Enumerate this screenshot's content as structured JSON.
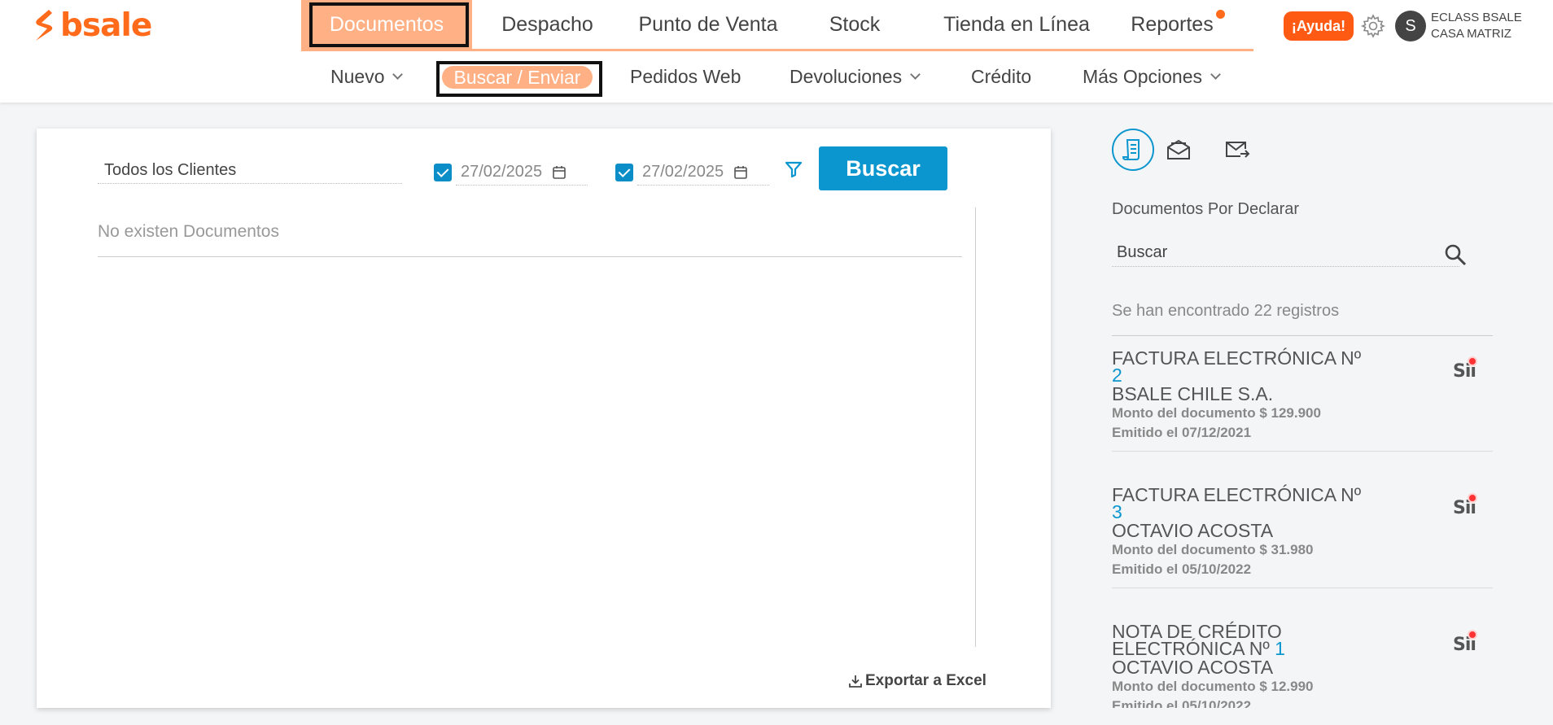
{
  "brand": {
    "logo_text": "bsale",
    "color": "#ff6b1a"
  },
  "main_nav": {
    "items": [
      "Documentos",
      "Despacho",
      "Punto de Venta",
      "Stock",
      "Tienda en Línea",
      "Reportes"
    ],
    "active": "Documentos"
  },
  "header": {
    "help_label": "¡Ayuda!",
    "avatar_initial": "S",
    "company_line1": "ECLASS BSALE",
    "company_line2": "CASA MATRIZ"
  },
  "sub_nav": {
    "items": [
      "Nuevo",
      "Buscar / Enviar",
      "Pedidos Web",
      "Devoluciones",
      "Crédito",
      "Más Opciones"
    ],
    "active": "Buscar / Enviar"
  },
  "search_form": {
    "client_placeholder": "Todos los Clientes",
    "date_from": "27/02/2025",
    "date_to": "27/02/2025",
    "search_label": "Buscar"
  },
  "results": {
    "empty_message": "No existen Documentos"
  },
  "export_label": "Exportar a Excel",
  "side_panel": {
    "title": "Documentos Por Declarar",
    "search_placeholder": "Buscar",
    "found_text": "Se han encontrado 22 registros",
    "documents": [
      {
        "title": "FACTURA ELECTRÓNICA Nº",
        "number": "2",
        "client": "BSALE CHILE S.A.",
        "amount": "Monto del documento $ 129.900",
        "issued": "Emitido el 07/12/2021"
      },
      {
        "title": "FACTURA ELECTRÓNICA Nº",
        "number": "3",
        "client": "OCTAVIO ACOSTA",
        "amount": "Monto del documento $ 31.980",
        "issued": "Emitido el 05/10/2022"
      },
      {
        "title": "NOTA DE CRÉDITO ELECTRÓNICA Nº",
        "number": "1",
        "client": "OCTAVIO ACOSTA",
        "amount": "Monto del documento $ 12.990",
        "issued": "Emitido el 05/10/2022"
      }
    ],
    "sii_label": "Sii"
  },
  "colors": {
    "accent": "#0b96cf",
    "active_tab": "#ffb085",
    "help": "#ff5a14"
  }
}
